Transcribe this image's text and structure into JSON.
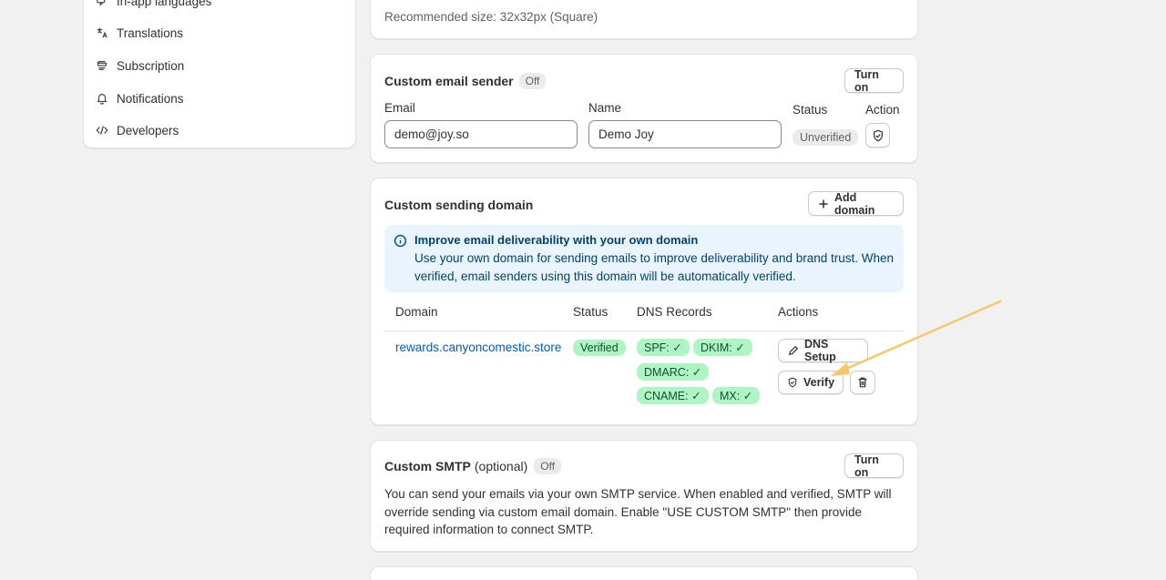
{
  "sidebar": {
    "items": [
      {
        "label": "In-app languages",
        "icon": "languages-icon"
      },
      {
        "label": "Translations",
        "icon": "translate-icon"
      },
      {
        "label": "Subscription",
        "icon": "subscription-icon"
      },
      {
        "label": "Notifications",
        "icon": "bell-icon"
      },
      {
        "label": "Developers",
        "icon": "code-icon"
      }
    ]
  },
  "icon_card": {
    "hint": "Recommended size: 32x32px (Square)"
  },
  "email_sender": {
    "title": "Custom email sender",
    "badge": "Off",
    "turn_on": "Turn on",
    "email_label": "Email",
    "email_value": "demo@joy.so",
    "name_label": "Name",
    "name_value": "Demo Joy",
    "status_label": "Status",
    "status_value": "Unverified",
    "action_label": "Action"
  },
  "sending_domain": {
    "title": "Custom sending domain",
    "add_domain": "Add domain",
    "banner_title": "Improve email deliverability with your own domain",
    "banner_text": "Use your own domain for sending emails to improve deliverability and brand trust. When verified, email senders using this domain will be automatically verified.",
    "columns": [
      "Domain",
      "Status",
      "DNS Records",
      "Actions"
    ],
    "row": {
      "domain": "rewards.canyoncomestic.store",
      "status": "Verified",
      "records": [
        "SPF: ✓",
        "DKIM: ✓",
        "DMARC: ✓",
        "CNAME: ✓",
        "MX: ✓"
      ],
      "dns_setup": "DNS Setup",
      "verify": "Verify"
    }
  },
  "smtp": {
    "title": "Custom SMTP",
    "optional": "(optional)",
    "badge": "Off",
    "turn_on": "Turn on",
    "description": "You can send your emails via your own SMTP service. When enabled and verified, SMTP will override sending via custom email domain. Enable \"USE CUSTOM SMTP\" then provide required information to connect SMTP."
  },
  "colors": {
    "page_bg": "#f1f1f1",
    "link": "#005bd3",
    "verified_bg": "#aff5c4",
    "banner_bg": "#eaf4ff",
    "annotation_arrow": "#f5c86b"
  }
}
